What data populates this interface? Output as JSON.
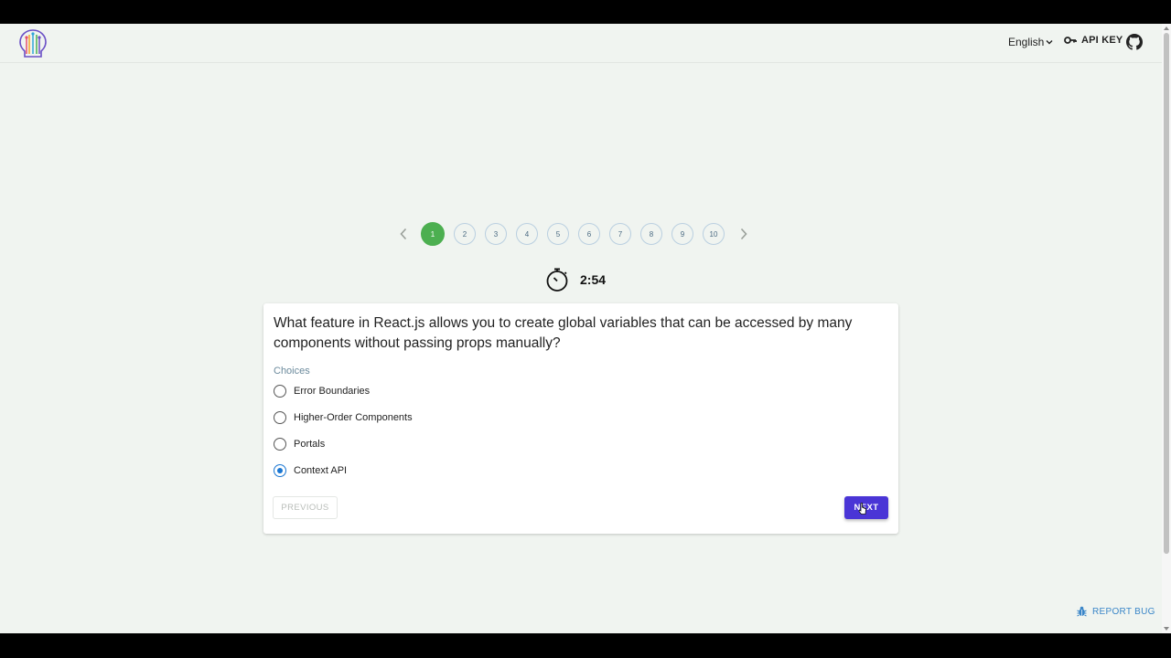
{
  "header": {
    "language": "English",
    "api_key_label": "API KEY"
  },
  "pagination": {
    "pages": [
      "1",
      "2",
      "3",
      "4",
      "5",
      "6",
      "7",
      "8",
      "9",
      "10"
    ],
    "active_page": "1"
  },
  "timer": {
    "remaining": "2:54"
  },
  "quiz": {
    "question": "What feature in React.js allows you to create global variables that can be accessed by many components without passing props manually?",
    "choices_label": "Choices",
    "choices": [
      "Error Boundaries",
      "Higher-Order Components",
      "Portals",
      "Context API"
    ],
    "selected_choice": "Context API",
    "previous_label": "PREVIOUS",
    "next_label": "NEXT"
  },
  "footer": {
    "report_bug_label": "REPORT BUG"
  },
  "colors": {
    "background": "#f0f4f0",
    "active_page": "#4caf50",
    "next_button": "#4a35d6",
    "radio_selected": "#1976d2",
    "report_bug": "#3a86c8"
  },
  "icons": [
    "logo-icon",
    "chevron-down-icon",
    "key-icon",
    "github-icon",
    "chevron-left-icon",
    "chevron-right-icon",
    "stopwatch-icon",
    "bug-icon",
    "mouse-cursor-icon"
  ]
}
